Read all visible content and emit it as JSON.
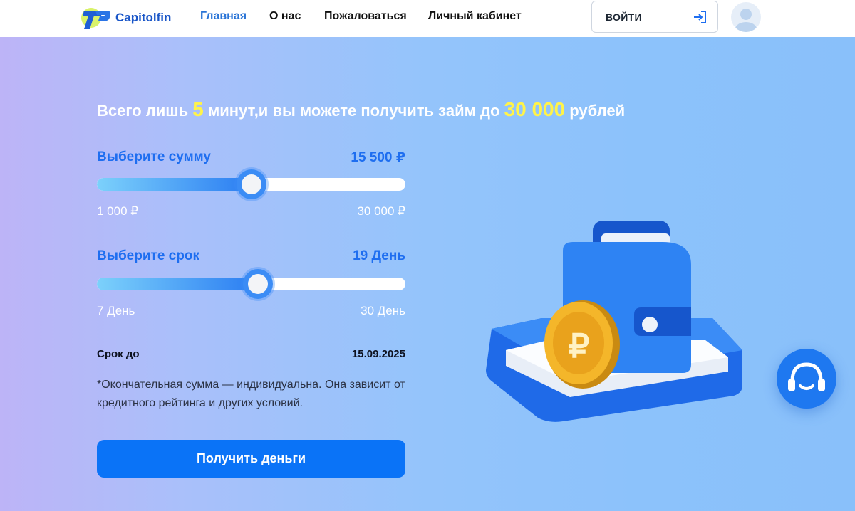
{
  "header": {
    "logo_text": "Capitolfin",
    "nav": [
      {
        "label": "Главная",
        "active": true
      },
      {
        "label": "О нас",
        "active": false
      },
      {
        "label": "Пожаловаться",
        "active": false
      },
      {
        "label": "Личный кабинет",
        "active": false
      }
    ],
    "login_label": "ВОЙТИ",
    "login_icon": "login-arrow-icon",
    "avatar_icon": "user-avatar-icon"
  },
  "hero": {
    "headline_part1": "Всего лишь",
    "headline_minutes": "5",
    "headline_part2": "минут,и вы можете получить займ до",
    "headline_amount": "30 000",
    "headline_part3": "рублей",
    "amount": {
      "label": "Выберите сумму",
      "value_text": "15 500 ₽",
      "value": 15500,
      "min_text": "1 000 ₽",
      "max_text": "30 000 ₽",
      "min": 1000,
      "max": 30000
    },
    "term": {
      "label": "Выберите срок",
      "value_text": "19 День",
      "value": 19,
      "min_text": "7 День",
      "max_text": "30 День",
      "min": 7,
      "max": 30
    },
    "due_label": "Срок до",
    "due_date": "15.09.2025",
    "note": "*Окончательная сумма — индивидуальна. Она зависит от кредитного рейтинга и других условий.",
    "cta_label": "Получить деньги"
  },
  "colors": {
    "brand": "#1a56c8",
    "accent": "#0a73f7",
    "highlight": "#fff34a",
    "slider_label": "#1e6ef0"
  },
  "icons": {
    "illustration": "wallet-with-ruble-coin-illustration",
    "support": "support-headset-icon"
  }
}
